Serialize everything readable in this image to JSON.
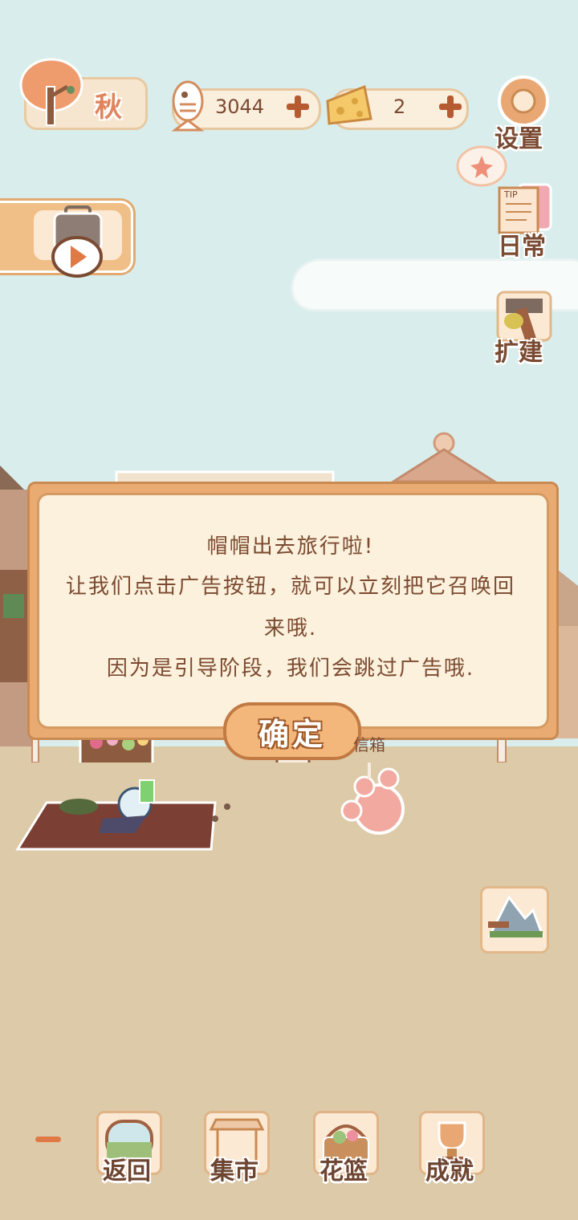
{
  "hud": {
    "season": "秋",
    "fish_count": "3044",
    "cheese_count": "2"
  },
  "side_menu": {
    "settings": "设置",
    "daily": "日常",
    "daily_note": "TIP",
    "expand": "扩建"
  },
  "scene": {
    "shop_sign": "信箱"
  },
  "dialog": {
    "line1": "帽帽出去旅行啦!",
    "line2": "让我们点击广告按钮，就可以立刻把它召唤回",
    "line3": "来哦.",
    "line4": "因为是引导阶段，我们会跳过广告哦.",
    "confirm": "确定"
  },
  "bottom_nav": {
    "items": [
      {
        "label": "返回",
        "icon": "window-icon"
      },
      {
        "label": "集市",
        "icon": "market-stall-icon"
      },
      {
        "label": "花篮",
        "icon": "flower-basket-icon"
      },
      {
        "label": "成就",
        "icon": "trophy-icon"
      }
    ]
  },
  "colors": {
    "sky": "#d9eeec",
    "ground": "#dccaa8",
    "panel": "#fbf1dd",
    "accent": "#e9ab72",
    "text": "#7c4a30"
  }
}
